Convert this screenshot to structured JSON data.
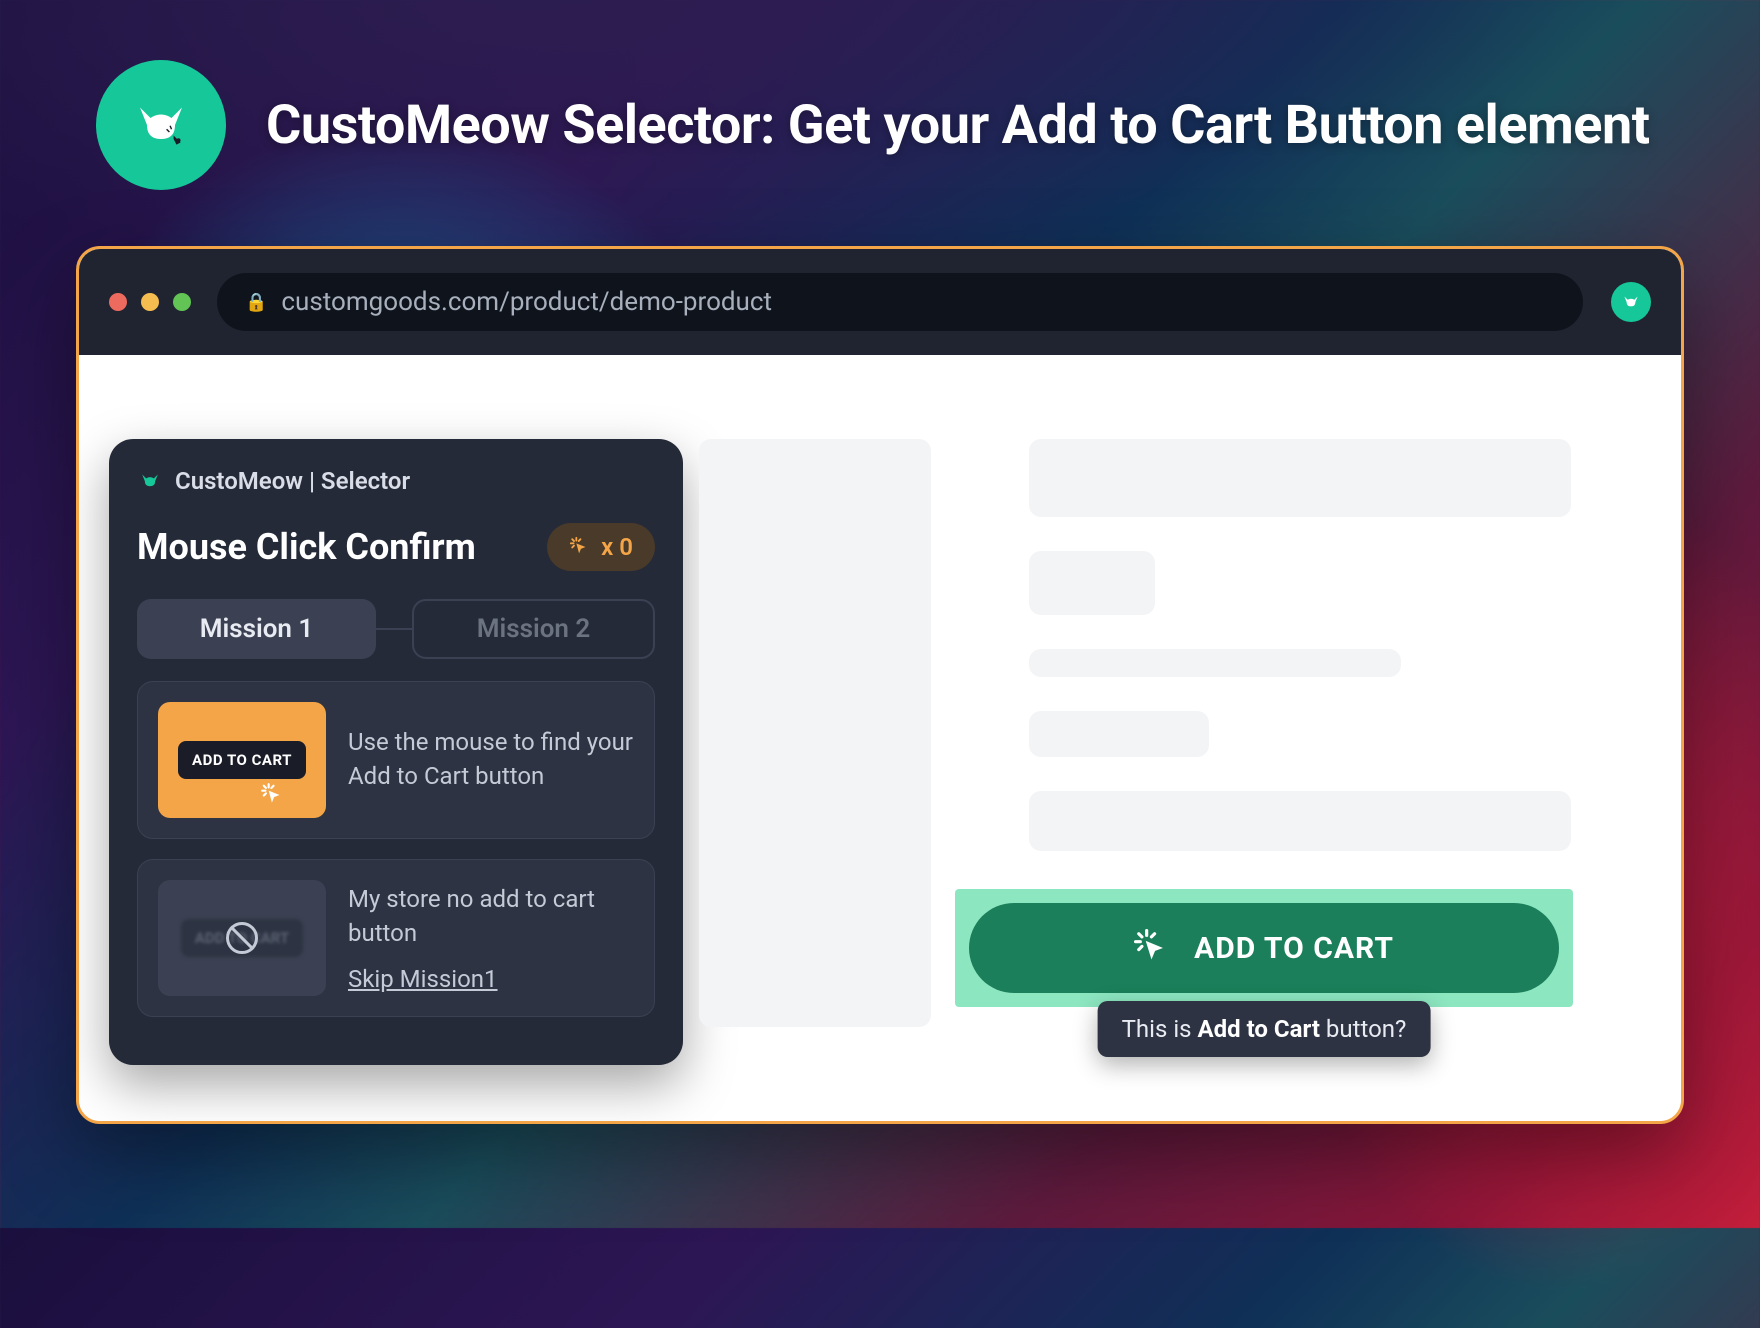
{
  "header": {
    "title": "CustoMeow Selector: Get your Add to Cart Button element"
  },
  "browser": {
    "url": "customgoods.com/product/demo-product"
  },
  "panel": {
    "brand": "CustoMeow | Selector",
    "title": "Mouse Click Confirm",
    "counter": "x 0",
    "missions": [
      {
        "label": "Mission 1",
        "active": true
      },
      {
        "label": "Mission 2",
        "active": false
      }
    ],
    "instruction1": {
      "preview_label": "ADD TO CART",
      "text": "Use the mouse to find your Add to Cart button"
    },
    "instruction2": {
      "preview_label": "ADD TO CART",
      "text": "My store no add to cart button",
      "skip": "Skip Mission1"
    }
  },
  "page": {
    "atc_label": "ADD TO CART",
    "tooltip_prefix": "This is ",
    "tooltip_bold": "Add to Cart",
    "tooltip_suffix": " button?"
  }
}
